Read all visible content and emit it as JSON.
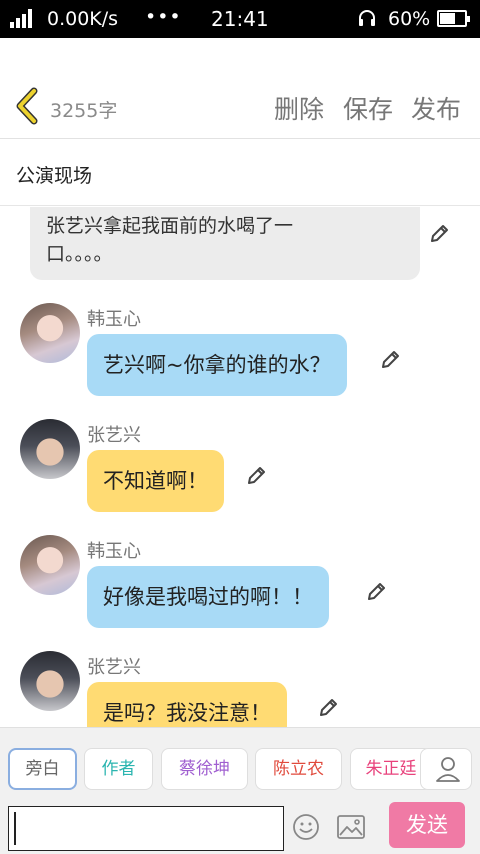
{
  "status_bar": {
    "network": "4G",
    "speed": "0.00K/s",
    "extra": "•••",
    "time": "21:41",
    "battery": "60%"
  },
  "toolbar": {
    "word_count": "3255字",
    "delete_label": "删除",
    "save_label": "保存",
    "publish_label": "发布"
  },
  "title": "公演现场",
  "messages": [
    {
      "type": "narration",
      "text_line1": "张艺兴拿起我面前的水喝了一",
      "text_line2": "口。。。。"
    },
    {
      "type": "dialog",
      "speaker": "韩玉心",
      "text": "艺兴啊~你拿的谁的水？",
      "color": "#a8daf6"
    },
    {
      "type": "dialog",
      "speaker": "张艺兴",
      "text": "不知道啊！",
      "color": "#ffdb73"
    },
    {
      "type": "dialog",
      "speaker": "韩玉心",
      "text": "好像是我喝过的啊！！",
      "color": "#a8daf6"
    },
    {
      "type": "dialog",
      "speaker": "张艺兴",
      "text": "是吗？我没注意！",
      "color": "#ffdb73"
    }
  ],
  "roles": [
    {
      "label": "旁白",
      "color": "#666666",
      "selected": true
    },
    {
      "label": "作者",
      "color": "#2bb5b0",
      "selected": false
    },
    {
      "label": "蔡徐坤",
      "color": "#a05fd0",
      "selected": false
    },
    {
      "label": "陈立农",
      "color": "#e04a3c",
      "selected": false
    },
    {
      "label": "朱正廷",
      "color": "#e8427c",
      "selected": false
    }
  ],
  "input": {
    "value": "",
    "send_label": "发送"
  },
  "icons": {
    "back": "chevron-left-icon",
    "edit": "pencil-icon",
    "add_role": "person-add-icon",
    "emoji": "smiley-icon",
    "image": "image-icon"
  },
  "colors": {
    "accent": "#f07aa5",
    "back_icon": "#ecd22e",
    "blue_bubble": "#a8daf6",
    "yellow_bubble": "#ffdb73"
  }
}
